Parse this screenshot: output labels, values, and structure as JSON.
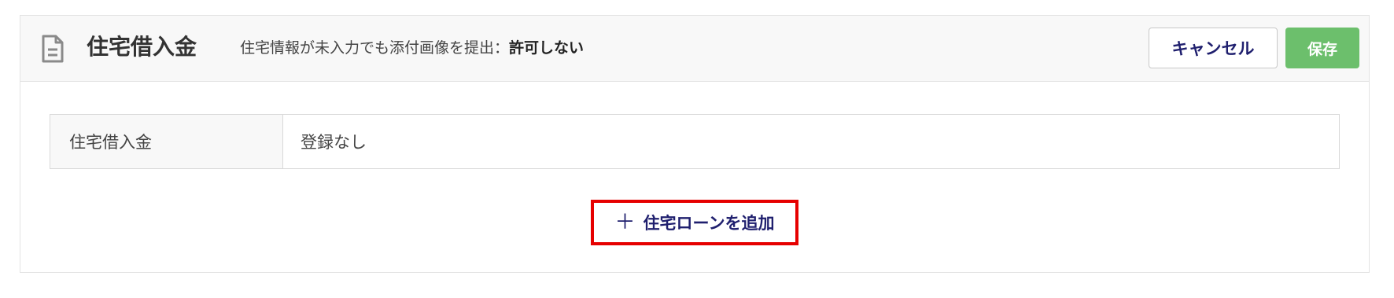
{
  "panel": {
    "title": "住宅借入金",
    "note_prefix": "住宅情報が未入力でも添付画像を提出：",
    "note_value": "許可しない",
    "icon": "document-icon"
  },
  "actions": {
    "cancel_label": "キャンセル",
    "save_label": "保存",
    "save_color": "#6cbf6c",
    "cancel_text_color": "#1f1f6e"
  },
  "table": {
    "rows": [
      {
        "label": "住宅借入金",
        "value": "登録なし"
      }
    ]
  },
  "add_button": {
    "icon": "plus-icon",
    "symbol": "＋",
    "label": "住宅ローンを追加",
    "highlight_color": "#e60000"
  }
}
